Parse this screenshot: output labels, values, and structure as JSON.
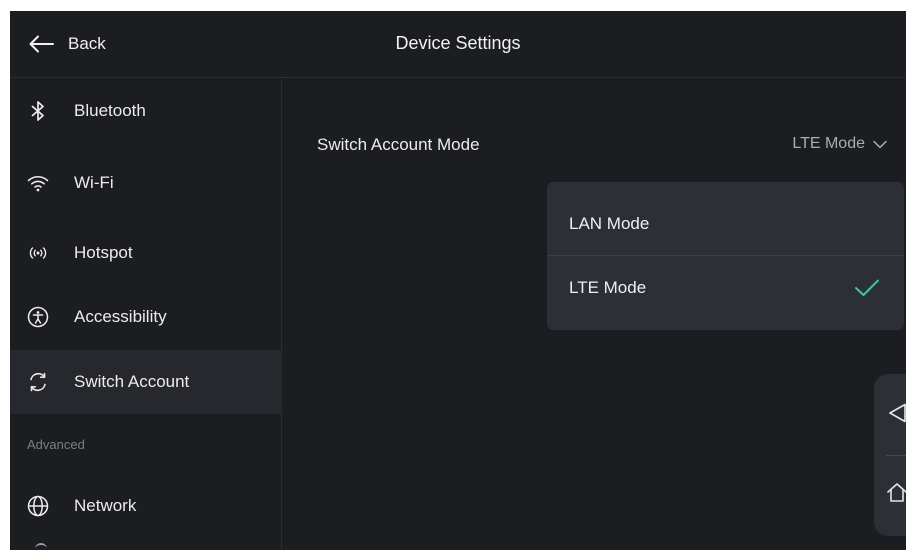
{
  "header": {
    "back_label": "Back",
    "title": "Device Settings"
  },
  "sidebar": {
    "items": [
      {
        "label": "Bluetooth",
        "icon": "bluetooth-icon"
      },
      {
        "label": "Wi-Fi",
        "icon": "wifi-icon"
      },
      {
        "label": "Hotspot",
        "icon": "hotspot-icon"
      },
      {
        "label": "Accessibility",
        "icon": "accessibility-icon"
      },
      {
        "label": "Switch Account",
        "icon": "switch-account-icon",
        "active": true
      }
    ],
    "section_label": "Advanced",
    "advanced_items": [
      {
        "label": "Network",
        "icon": "globe-icon"
      }
    ]
  },
  "content": {
    "setting_label": "Switch Account Mode",
    "setting_value": "LTE Mode"
  },
  "dropdown": {
    "options": [
      {
        "label": "LAN Mode",
        "selected": false
      },
      {
        "label": "LTE Mode",
        "selected": true
      }
    ]
  },
  "colors": {
    "background": "#1b1d21",
    "active_row": "#26282d",
    "popup": "#2c2f35",
    "check": "#3ec89a"
  }
}
